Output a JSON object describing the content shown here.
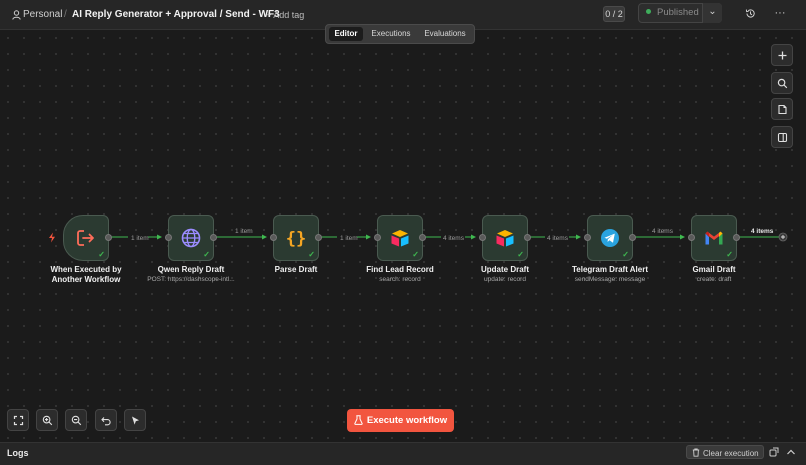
{
  "topbar": {
    "project": "Personal",
    "separator": "/",
    "workflow_title": "AI Reply Generator + Approval / Send - WF3",
    "add_tag": "+ Add tag",
    "counter": "0 / 2",
    "published": "Published",
    "caret": "⌄",
    "more": "···"
  },
  "tabs": {
    "editor": "Editor",
    "executions": "Executions",
    "evaluations": "Evaluations",
    "active": "Editor"
  },
  "nodes": [
    {
      "label": "When Executed by\nAnother Workflow",
      "sub": "",
      "icon": "exit-icon"
    },
    {
      "label": "Qwen Reply Draft",
      "sub": "POST: https://dashscope-intl...",
      "icon": "globe-icon"
    },
    {
      "label": "Parse Draft",
      "sub": "",
      "icon": "braces-icon"
    },
    {
      "label": "Find Lead Record",
      "sub": "search: record",
      "icon": "airtable-icon"
    },
    {
      "label": "Update Draft",
      "sub": "update: record",
      "icon": "airtable-icon"
    },
    {
      "label": "Telegram Draft Alert",
      "sub": "sendMessage: message",
      "icon": "telegram-icon"
    },
    {
      "label": "Gmail Draft",
      "sub": "create: draft",
      "icon": "gmail-icon"
    }
  ],
  "edges": [
    "1 item",
    "1 item",
    "1 item",
    "4 items",
    "4 items",
    "4 items",
    "4 items"
  ],
  "execute_button": "Execute workflow",
  "logs": {
    "title": "Logs",
    "clear": "Clear execution"
  },
  "colors": {
    "accent": "#f2553f",
    "success": "#3fb950",
    "node_bg": "#2b3a31"
  }
}
